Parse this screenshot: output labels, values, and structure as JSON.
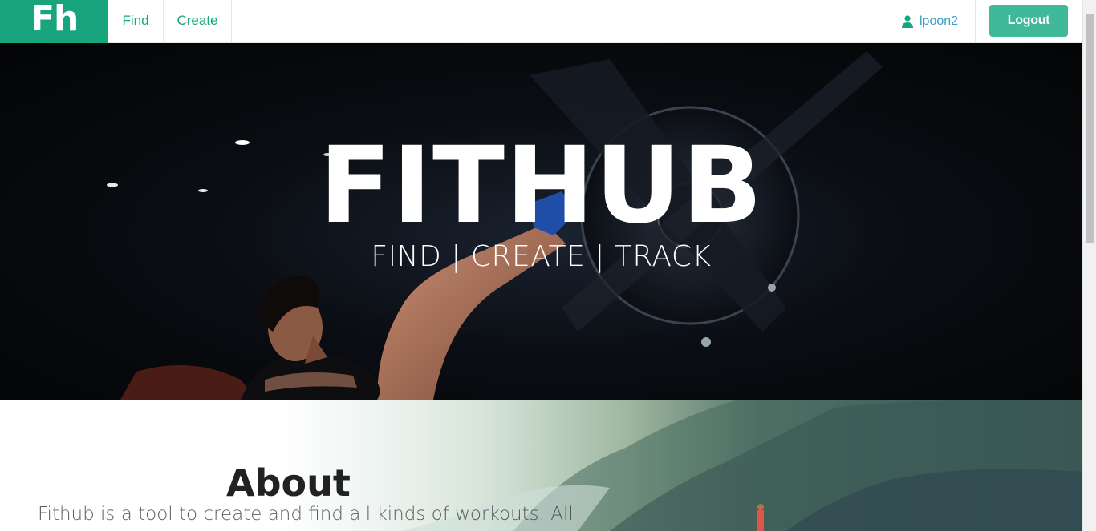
{
  "navbar": {
    "brand": "Fh",
    "links": [
      {
        "label": "Find"
      },
      {
        "label": "Create"
      }
    ],
    "user": {
      "name": "lpoon2",
      "icon": "user-icon"
    },
    "logout_label": "Logout",
    "accent_color": "#18a57e"
  },
  "hero": {
    "title": "FITHUB",
    "subtitle": "FIND | CREATE | TRACK"
  },
  "about": {
    "title": "About",
    "text": "Fithub is a tool to create and find all kinds of workouts. All"
  }
}
